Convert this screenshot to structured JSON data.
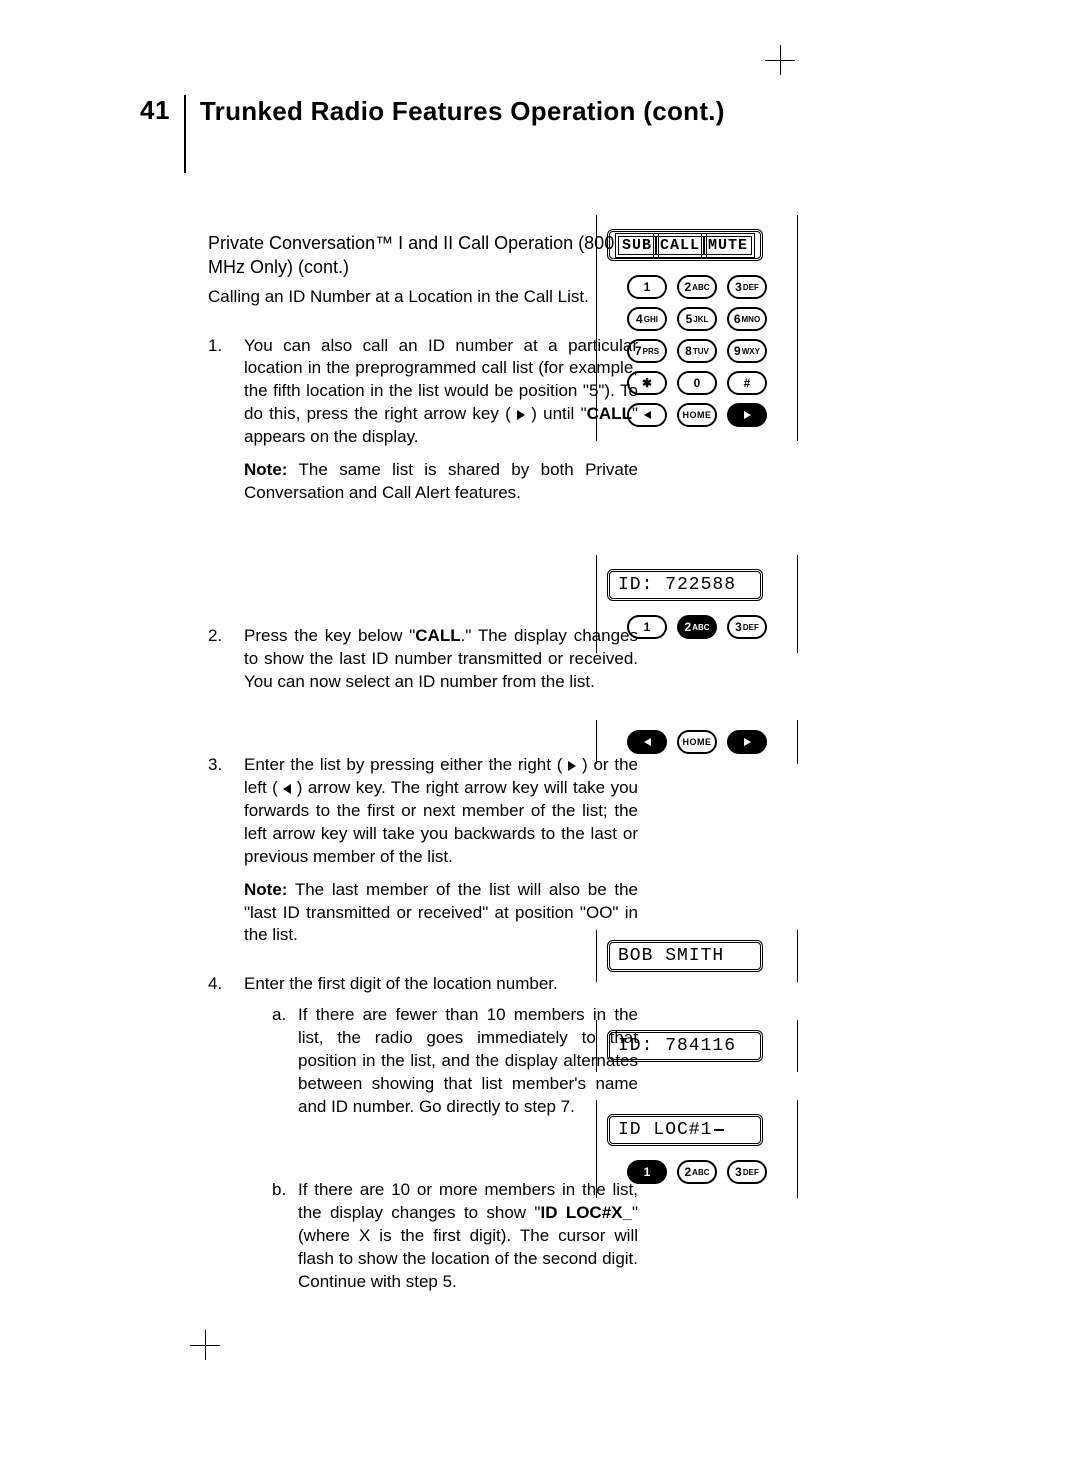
{
  "page_number": "41",
  "title": "Trunked Radio Features Operation (cont.)",
  "subhead": "Private Conversation™ I and II Call Operation (800 MHz Only) (cont.)",
  "caption": "Calling an ID Number at a Location in the Call List.",
  "steps": {
    "s1": {
      "num": "1.",
      "text_pre": "You can also call an ID number at a particular location in the preprogrammed call list (for example, the fifth location in the list would be position \"5\"). To do this, press the right arrow key (",
      "text_post": ") until \"",
      "bold": "CALL",
      "text_end": "\" appears on the display.",
      "note_label": "Note:",
      "note": "The same list is shared by both Private Conversation and Call Alert features."
    },
    "s2": {
      "num": "2.",
      "text_pre": "Press the key below \"",
      "bold": "CALL",
      "text_post": ".\" The display changes to show the last ID number transmitted or received. You can now select an ID number from the list."
    },
    "s3": {
      "num": "3.",
      "text_pre": "Enter the list by pressing either the right (",
      "text_mid": ") or the left (",
      "text_post": ") arrow key. The right arrow key will take you forwards to the first or next member of the list; the left arrow key will take you backwards to the last or previous member of the list.",
      "note_label": "Note:",
      "note": "The last member of the list will also be the \"last ID transmitted or received\" at position \"OO\" in the list."
    },
    "s4": {
      "num": "4.",
      "text": "Enter the first digit of the location number.",
      "a_lbl": "a.",
      "a": "If there are fewer than 10 members in the list, the radio goes immediately to that position in the list, and the display alternates between showing that list member's name and ID number. Go directly to step 7.",
      "b_lbl": "b.",
      "b_pre": "If there are 10 or more members in the list, the display changes to show \"",
      "b_bold": "ID LOC#X_",
      "b_post": "\" (where X is the first digit). The cursor will flash to show the location of the second digit. Continue with step 5."
    }
  },
  "displays": {
    "soft1": "SUB",
    "soft2": "CALL",
    "soft3": "MUTE",
    "id1": "ID: 722588",
    "name": "BOB SMITH",
    "id2": "ID: 784116",
    "loc": "ID LOC#1"
  },
  "keys": {
    "k1": "1",
    "k2": "2",
    "k2s": "ABC",
    "k3": "3",
    "k3s": "DEF",
    "k4": "4",
    "k4s": "GHI",
    "k5": "5",
    "k5s": "JKL",
    "k6": "6",
    "k6s": "MNO",
    "k7": "7",
    "k7s": "PRS",
    "k8": "8",
    "k8s": "TUV",
    "k9": "9",
    "k9s": "WXY",
    "kstar": "✱",
    "k0": "0",
    "khash": "#",
    "home": "HOME"
  }
}
